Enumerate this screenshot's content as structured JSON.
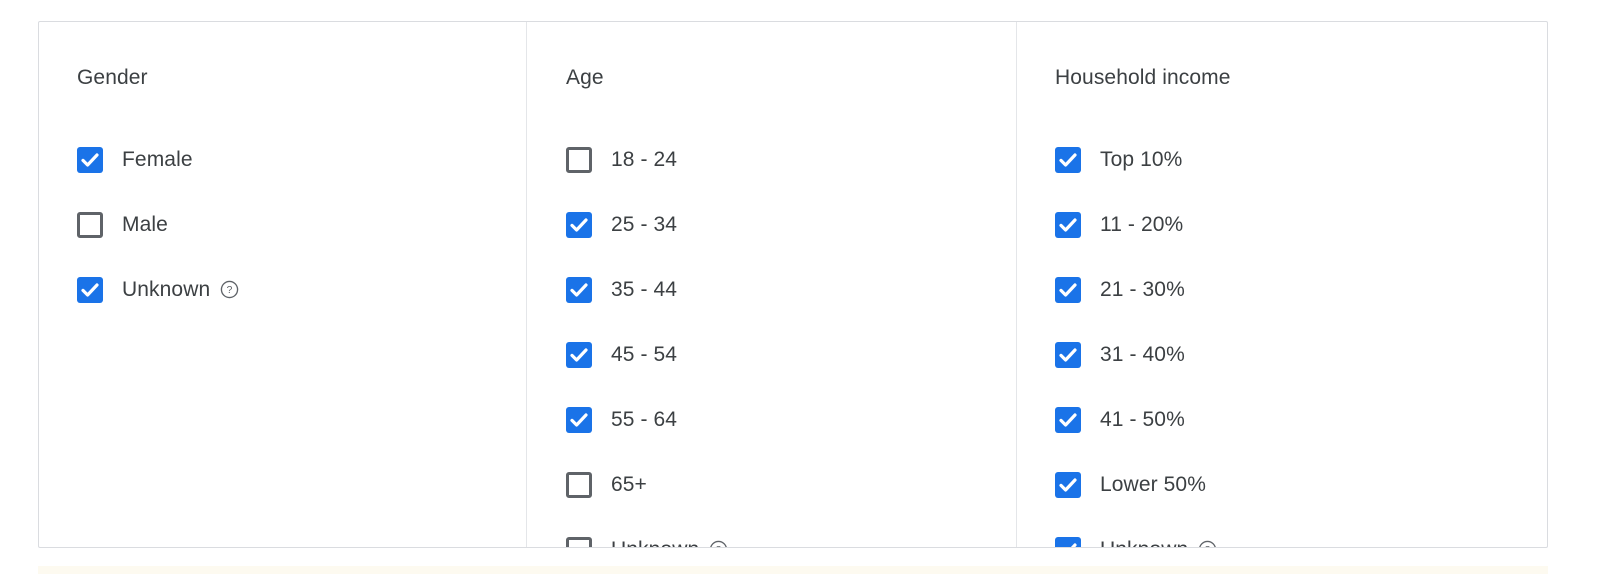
{
  "panel": {
    "accent_color": "#1a73e8",
    "text_color": "#3c4043",
    "border_color": "#dadce0",
    "divider_color": "#e4e6e9",
    "unchecked_border_color": "#5f6368",
    "bottom_band_color": "#fdfaf0"
  },
  "columns": [
    {
      "title": "Gender",
      "options": [
        {
          "label": "Female",
          "checked": true,
          "help": false
        },
        {
          "label": "Male",
          "checked": false,
          "help": false
        },
        {
          "label": "Unknown",
          "checked": true,
          "help": true
        }
      ]
    },
    {
      "title": "Age",
      "options": [
        {
          "label": "18 - 24",
          "checked": false,
          "help": false
        },
        {
          "label": "25 - 34",
          "checked": true,
          "help": false
        },
        {
          "label": "35 - 44",
          "checked": true,
          "help": false
        },
        {
          "label": "45 - 54",
          "checked": true,
          "help": false
        },
        {
          "label": "55 - 64",
          "checked": true,
          "help": false
        },
        {
          "label": "65+",
          "checked": false,
          "help": false
        },
        {
          "label": "Unknown",
          "checked": false,
          "help": true
        }
      ]
    },
    {
      "title": "Household income",
      "options": [
        {
          "label": "Top 10%",
          "checked": true,
          "help": false
        },
        {
          "label": "11 - 20%",
          "checked": true,
          "help": false
        },
        {
          "label": "21 - 30%",
          "checked": true,
          "help": false
        },
        {
          "label": "31 - 40%",
          "checked": true,
          "help": false
        },
        {
          "label": "41 - 50%",
          "checked": true,
          "help": false
        },
        {
          "label": "Lower 50%",
          "checked": true,
          "help": false
        },
        {
          "label": "Unknown",
          "checked": true,
          "help": true
        }
      ]
    }
  ],
  "icons": {
    "checkmark": "check-icon",
    "help": "help-circle-icon"
  }
}
